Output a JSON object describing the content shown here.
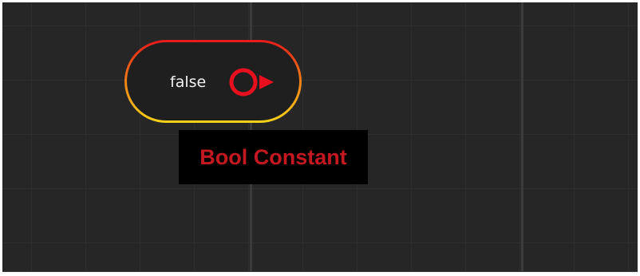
{
  "canvas": {
    "background_color": "#262626",
    "grid_color": "#2e2e2e",
    "major_grid_color": "#3b3b3b"
  },
  "node": {
    "value": "false",
    "value_color": "#f2f2f2",
    "body_color": "#1f1f1f",
    "border_gradient": [
      "#e51a1a",
      "#ee7f16",
      "#f4d21a"
    ],
    "output_port": {
      "icon": "output-pin-icon",
      "color": "#e8101e"
    }
  },
  "tooltip": {
    "label": "Bool Constant",
    "text_color": "#c41820",
    "background_color": "#000000"
  }
}
